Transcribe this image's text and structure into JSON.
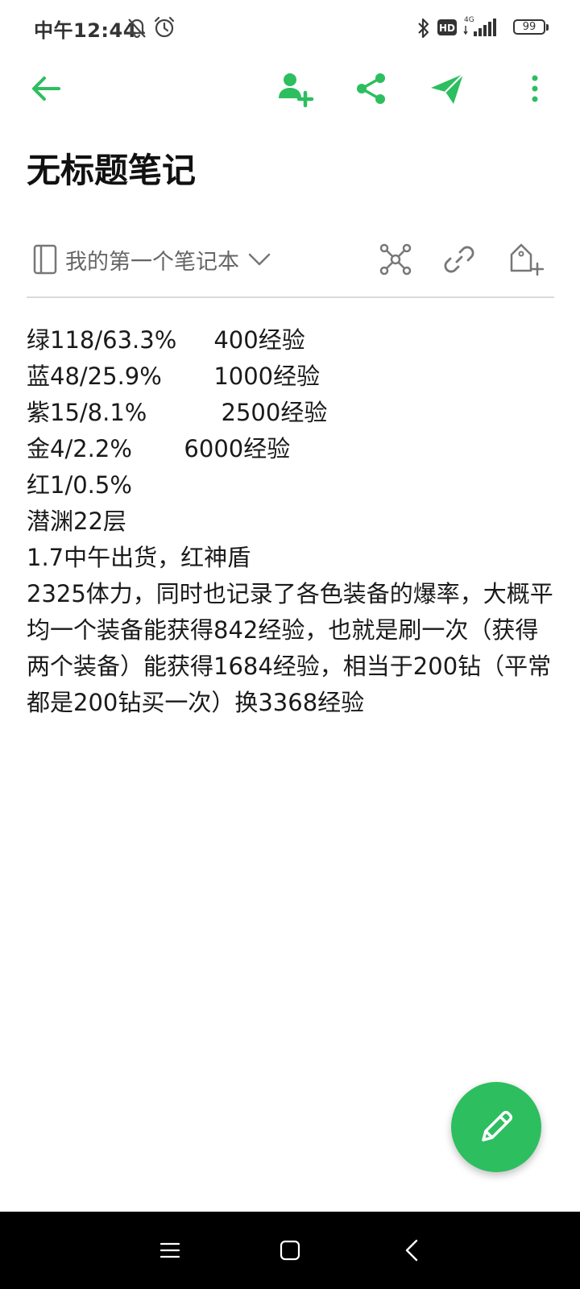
{
  "status_bar": {
    "time": "中午12:44",
    "battery": "99",
    "network": "4G",
    "hd_badge": "HD",
    "icons": [
      "mute-bell-icon",
      "alarm-icon",
      "bluetooth-icon",
      "hd-icon",
      "signal-icon",
      "battery-icon"
    ]
  },
  "toolbar": {
    "icons": [
      "back-arrow-icon",
      "add-user-icon",
      "share-icon",
      "send-icon",
      "more-vert-icon"
    ],
    "accent_color": "#2dbe60"
  },
  "note": {
    "title": "无标题笔记",
    "notebook": "我的第一个笔记本",
    "lines": [
      "绿118/63.3%     400经验",
      "蓝48/25.9%       1000经验",
      "紫15/8.1%          2500经验",
      "金4/2.2%       6000经验",
      "红1/0.5%",
      "潜渊22层",
      "1.7中午出货，红神盾"
    ],
    "paragraph": "2325体力，同时也记录了各色装备的爆率，大概平均一个装备能获得842经验，也就是刷一次（获得两个装备）能获得1684经验，相当于200钻（平常都是200钻买一次）换3368经验"
  },
  "meta_icons": [
    "connections-icon",
    "link-icon",
    "add-tag-icon"
  ],
  "fab": {
    "icon": "pencil-icon",
    "color": "#2dbe60"
  },
  "nav_bar": {
    "icons": [
      "menu-icon",
      "home-icon",
      "back-icon"
    ]
  }
}
